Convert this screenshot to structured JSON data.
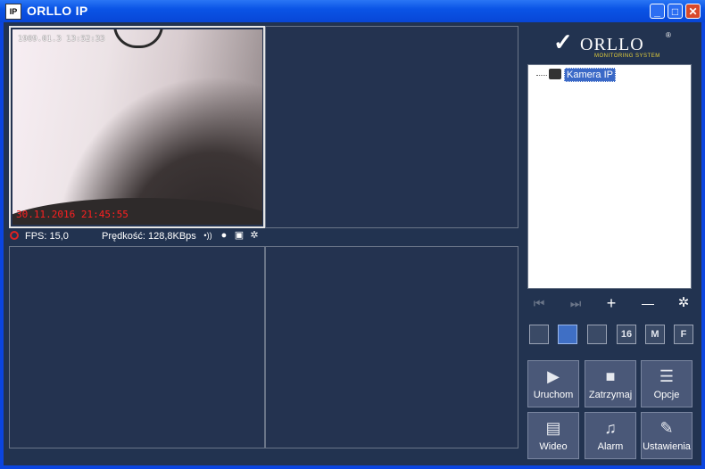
{
  "window": {
    "title": "ORLLO IP",
    "icon_label": "IP",
    "controls": [
      "minimize-icon",
      "maximize-icon",
      "close-icon"
    ],
    "control_glyphs": {
      "minimize": "_",
      "maximize": "□",
      "close": "✕"
    }
  },
  "video": {
    "active_cell": 1,
    "feed": {
      "osd_top": "1969.01.3   13:52:33",
      "osd_bottom": "30.11.2016 21:45:55"
    }
  },
  "status": {
    "fps": "FPS: 15,0",
    "speed": "Prędkość: 128,8KBps",
    "icons": [
      "audio-icon",
      "record-icon",
      "snapshot-icon",
      "settings-icon"
    ],
    "icon_glyphs": {
      "audio": "•))",
      "record": "●",
      "snapshot": "▣",
      "settings": "✲"
    }
  },
  "logo": {
    "name": "ORLLO",
    "sub": "MONITORING SYSTEM",
    "mark": "✓",
    "reg": "®"
  },
  "tree": {
    "items": [
      {
        "label": "Kamera IP"
      }
    ]
  },
  "nav": {
    "glyphs": {
      "prev": "⏮",
      "next": "⏭",
      "add": "+",
      "remove": "—",
      "settings": "✲"
    }
  },
  "layouts": [
    {
      "label": "",
      "name": "layout-1-button"
    },
    {
      "label": "",
      "name": "layout-4-button",
      "selected": true
    },
    {
      "label": "",
      "name": "layout-9-button"
    },
    {
      "label": "16",
      "name": "layout-16-button"
    },
    {
      "label": "M",
      "name": "layout-m-button"
    },
    {
      "label": "F",
      "name": "fullscreen-button"
    }
  ],
  "actions": [
    {
      "label": "Uruchom",
      "icon": "start-icon"
    },
    {
      "label": "Zatrzymaj",
      "icon": "stop-icon"
    },
    {
      "label": "Opcje",
      "icon": "options-icon"
    },
    {
      "label": "Wideo",
      "icon": "video-icon"
    },
    {
      "label": "Alarm",
      "icon": "alarm-icon"
    },
    {
      "label": "Ustawienia",
      "icon": "settings-icon"
    }
  ]
}
